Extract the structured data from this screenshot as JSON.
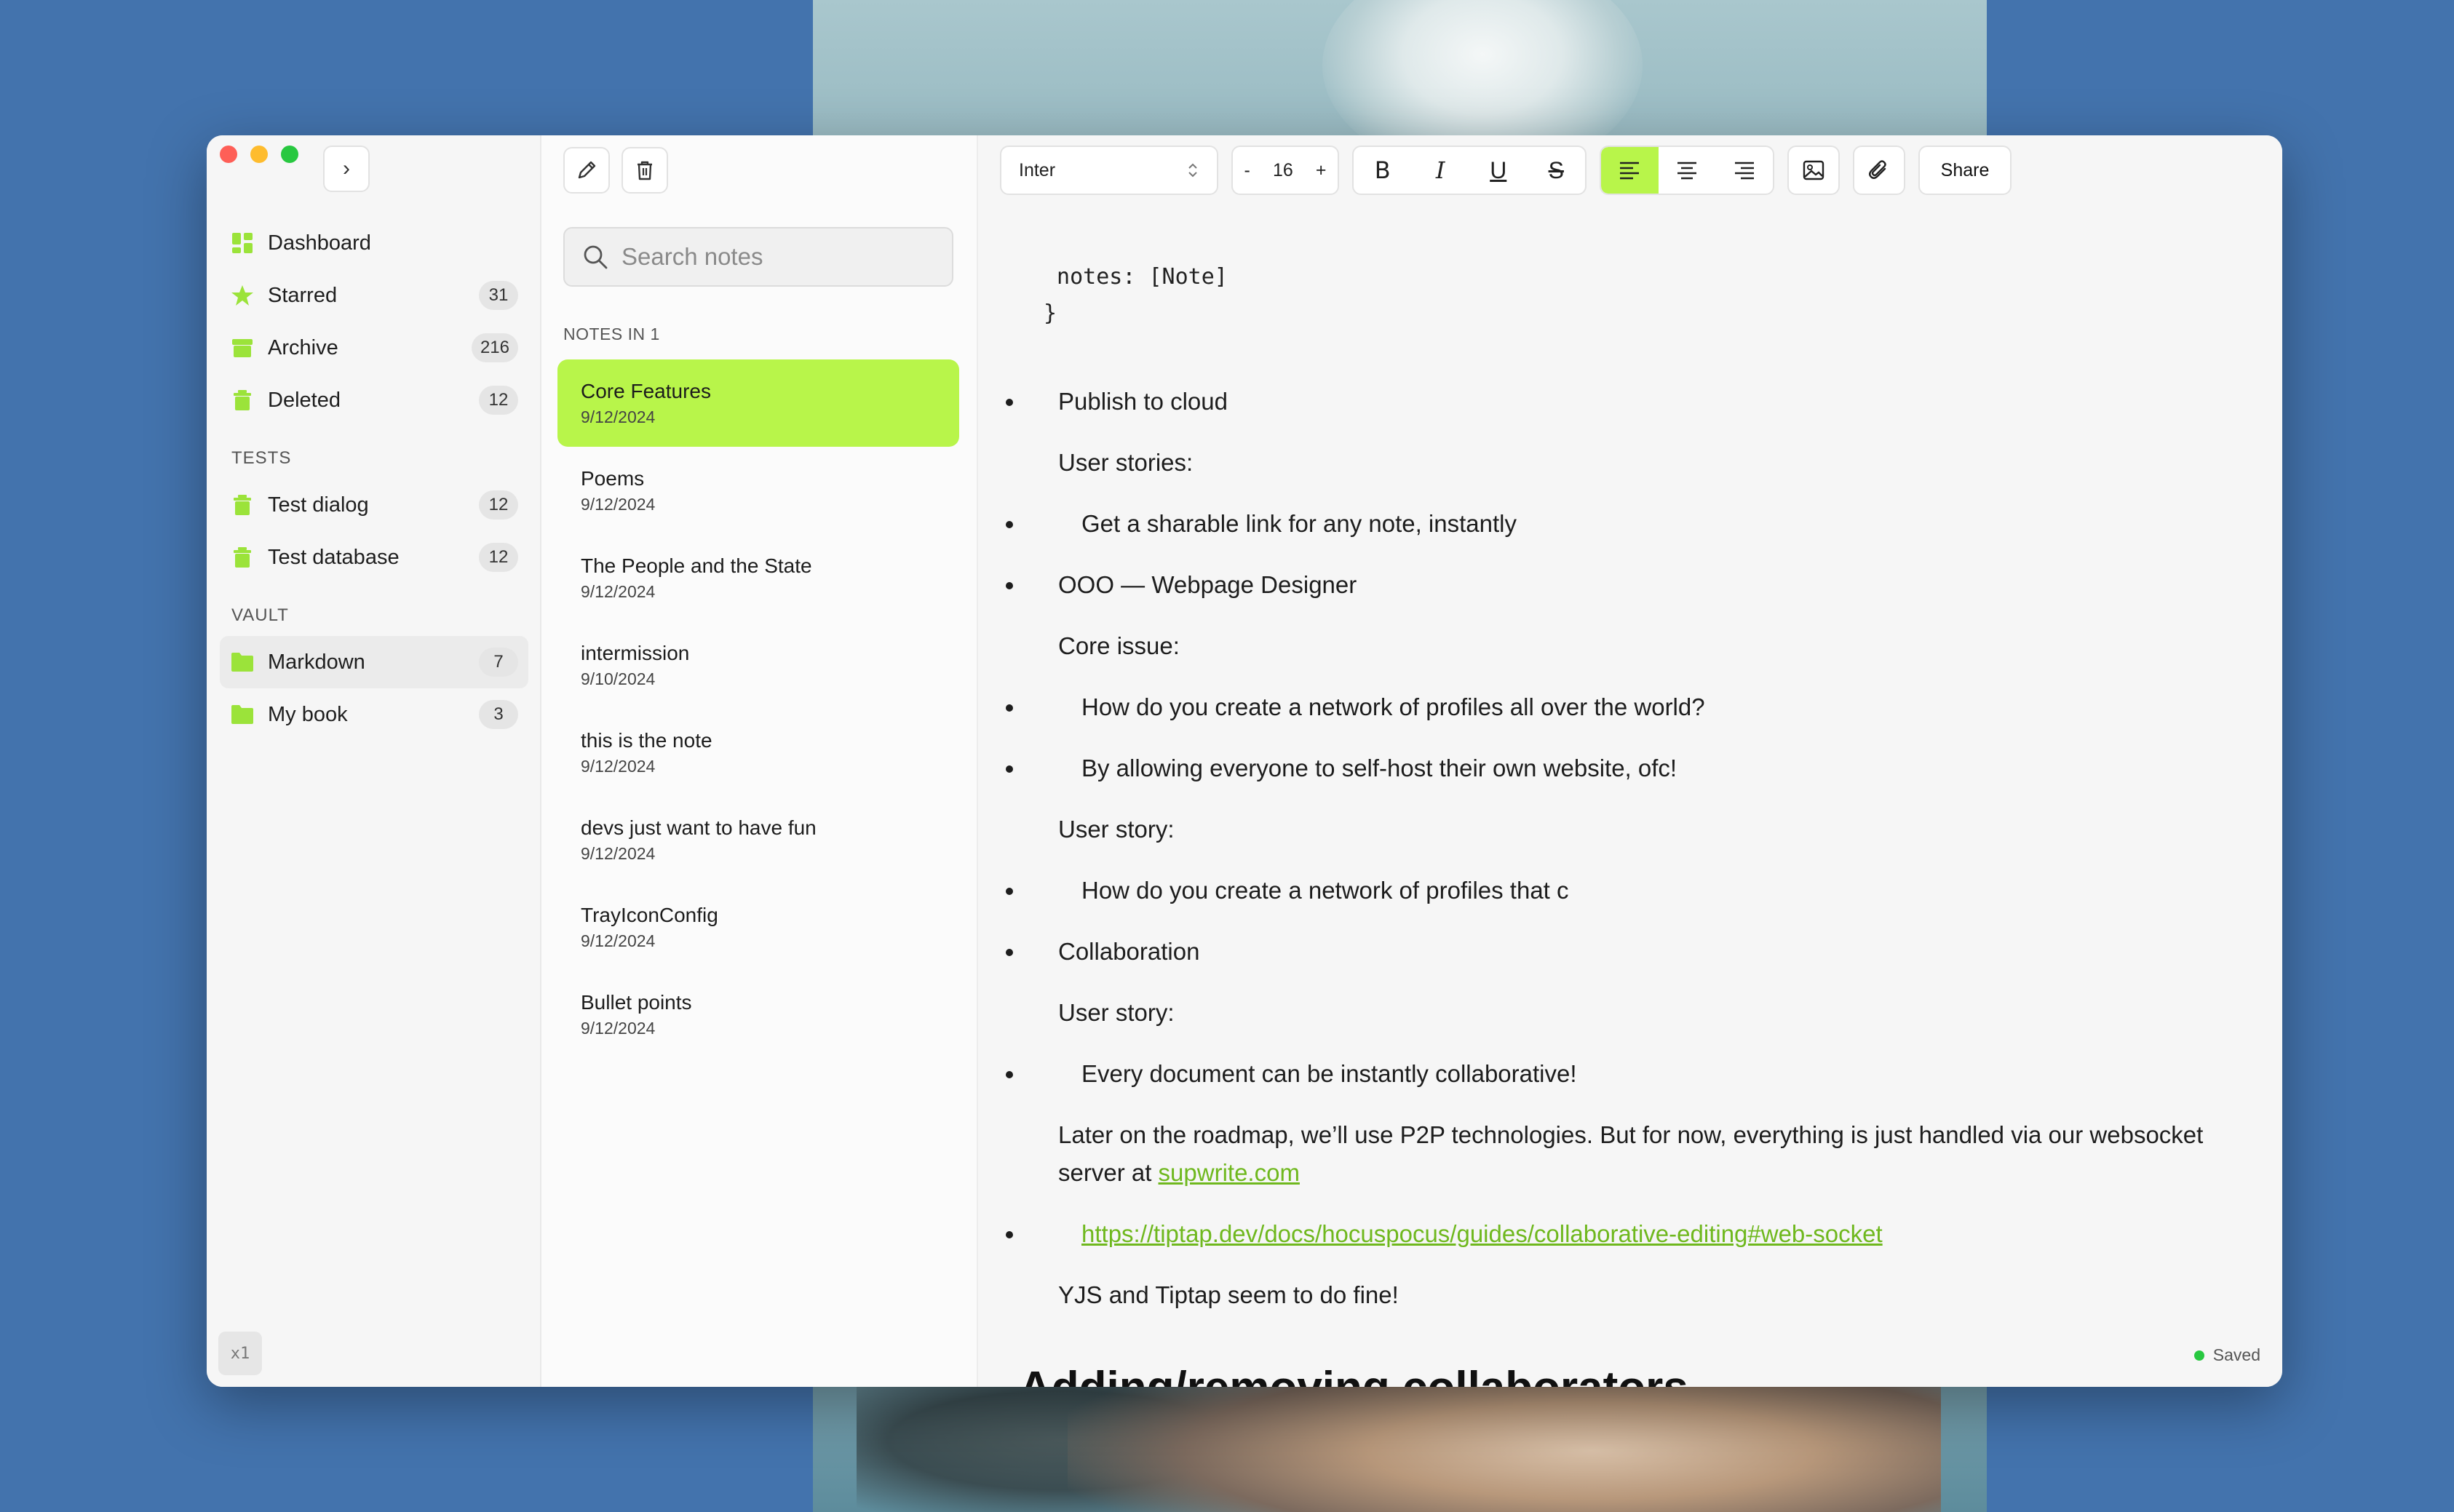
{
  "sidebar": {
    "expand_label": "›",
    "items": [
      {
        "label": "Dashboard",
        "count": ""
      },
      {
        "label": "Starred",
        "count": "31"
      },
      {
        "label": "Archive",
        "count": "216"
      },
      {
        "label": "Deleted",
        "count": "12"
      }
    ],
    "tests_title": "TESTS",
    "tests": [
      {
        "label": "Test dialog",
        "count": "12"
      },
      {
        "label": "Test database",
        "count": "12"
      }
    ],
    "vault_title": "VAULT",
    "vault": [
      {
        "label": "Markdown",
        "count": "7"
      },
      {
        "label": "My book",
        "count": "3"
      }
    ],
    "kbd": "x1"
  },
  "notelist": {
    "search_placeholder": "Search notes",
    "title": "NOTES IN 1",
    "notes": [
      {
        "title": "Core Features",
        "date": "9/12/2024"
      },
      {
        "title": "Poems",
        "date": "9/12/2024"
      },
      {
        "title": "The People and the State",
        "date": "9/12/2024"
      },
      {
        "title": "intermission",
        "date": "9/10/2024"
      },
      {
        "title": "this is the note",
        "date": "9/12/2024"
      },
      {
        "title": "devs just want to have fun",
        "date": "9/12/2024"
      },
      {
        "title": "TrayIconConfig",
        "date": "9/12/2024"
      },
      {
        "title": "Bullet points",
        "date": "9/12/2024"
      }
    ]
  },
  "toolbar": {
    "font": "Inter",
    "size_minus": "-",
    "size": "16",
    "size_plus": "+",
    "bold": "B",
    "italic": "I",
    "underline": "U",
    "strike": "S",
    "share": "Share"
  },
  "editor": {
    "code_line1": " notes: [Note]",
    "code_line2": "}",
    "b1": "Publish to cloud",
    "p1": "User stories:",
    "b1a": "Get a sharable link for any note, instantly",
    "b2": "OOO — Webpage Designer",
    "p2": "Core issue:",
    "b2a": "How do you create a network of profiles all over the world?",
    "b2b": "By allowing everyone to self-host their own website, ofc!",
    "p3": "User story:",
    "b2c": "How do you create a network of profiles that c",
    "b3": "Collaboration",
    "p4": "User story:",
    "b3a": "Every document can be instantly collaborative!",
    "p5": "Later on the roadmap, we’ll use P2P technologies. But for now, everything is just handled via our websocket server at ",
    "p5_link": "supwrite.com",
    "b4_link": "https://tiptap.dev/docs/hocuspocus/guides/collaborative-editing#web-socket",
    "p6": "YJS and Tiptap seem to do fine!",
    "heading": "Adding/removing collaborators",
    "status": "Saved"
  },
  "colors": {
    "accent": "#b8f54a",
    "link": "#6fb81e",
    "background": "#4373ad"
  }
}
